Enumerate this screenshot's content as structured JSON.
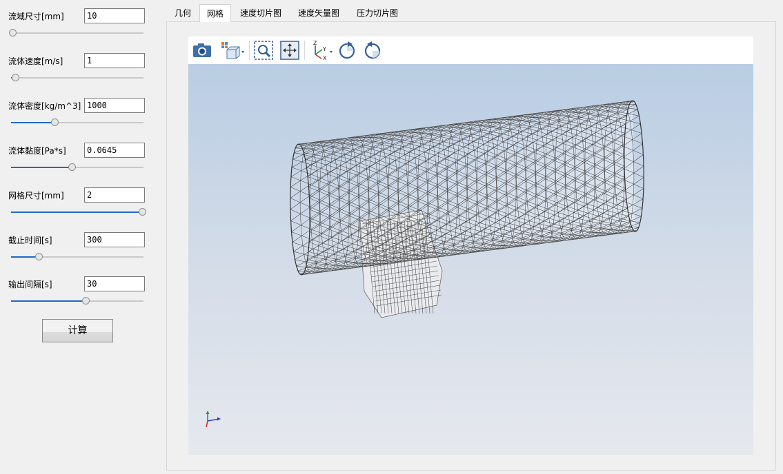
{
  "params": [
    {
      "label": "流域尺寸[mm]",
      "value": "10",
      "slider": 0.0
    },
    {
      "label": "流体速度[m/s]",
      "value": "1",
      "slider": 0.03
    },
    {
      "label": "流体密度[kg/m^3]",
      "value": "1000",
      "slider": 0.33
    },
    {
      "label": "流体黏度[Pa*s]",
      "value": "0.0645",
      "slider": 0.46
    },
    {
      "label": "网格尺寸[mm]",
      "value": "2",
      "slider": 1.0
    },
    {
      "label": "截止时间[s]",
      "value": "300",
      "slider": 0.21
    },
    {
      "label": "输出间隔[s]",
      "value": "30",
      "slider": 0.56
    }
  ],
  "calc_button": "计算",
  "tabs": [
    {
      "label": "几何",
      "active": false
    },
    {
      "label": "网格",
      "active": true
    },
    {
      "label": "速度切片图",
      "active": false
    },
    {
      "label": "速度矢量图",
      "active": false
    },
    {
      "label": "压力切片图",
      "active": false
    }
  ],
  "toolbar_icons": [
    "camera-icon",
    "view-cube-icon",
    "zoom-box-icon",
    "fit-all-icon",
    "axes-orientation-icon",
    "rotate-cw-icon",
    "rotate-ccw-icon"
  ],
  "axis_labels": {
    "z": "Z",
    "y": "Y",
    "x": "X"
  },
  "colors": {
    "slider_fill": "#1c69c8",
    "viewport_top": "#b9cde4",
    "viewport_bottom": "#e6e8ee"
  }
}
